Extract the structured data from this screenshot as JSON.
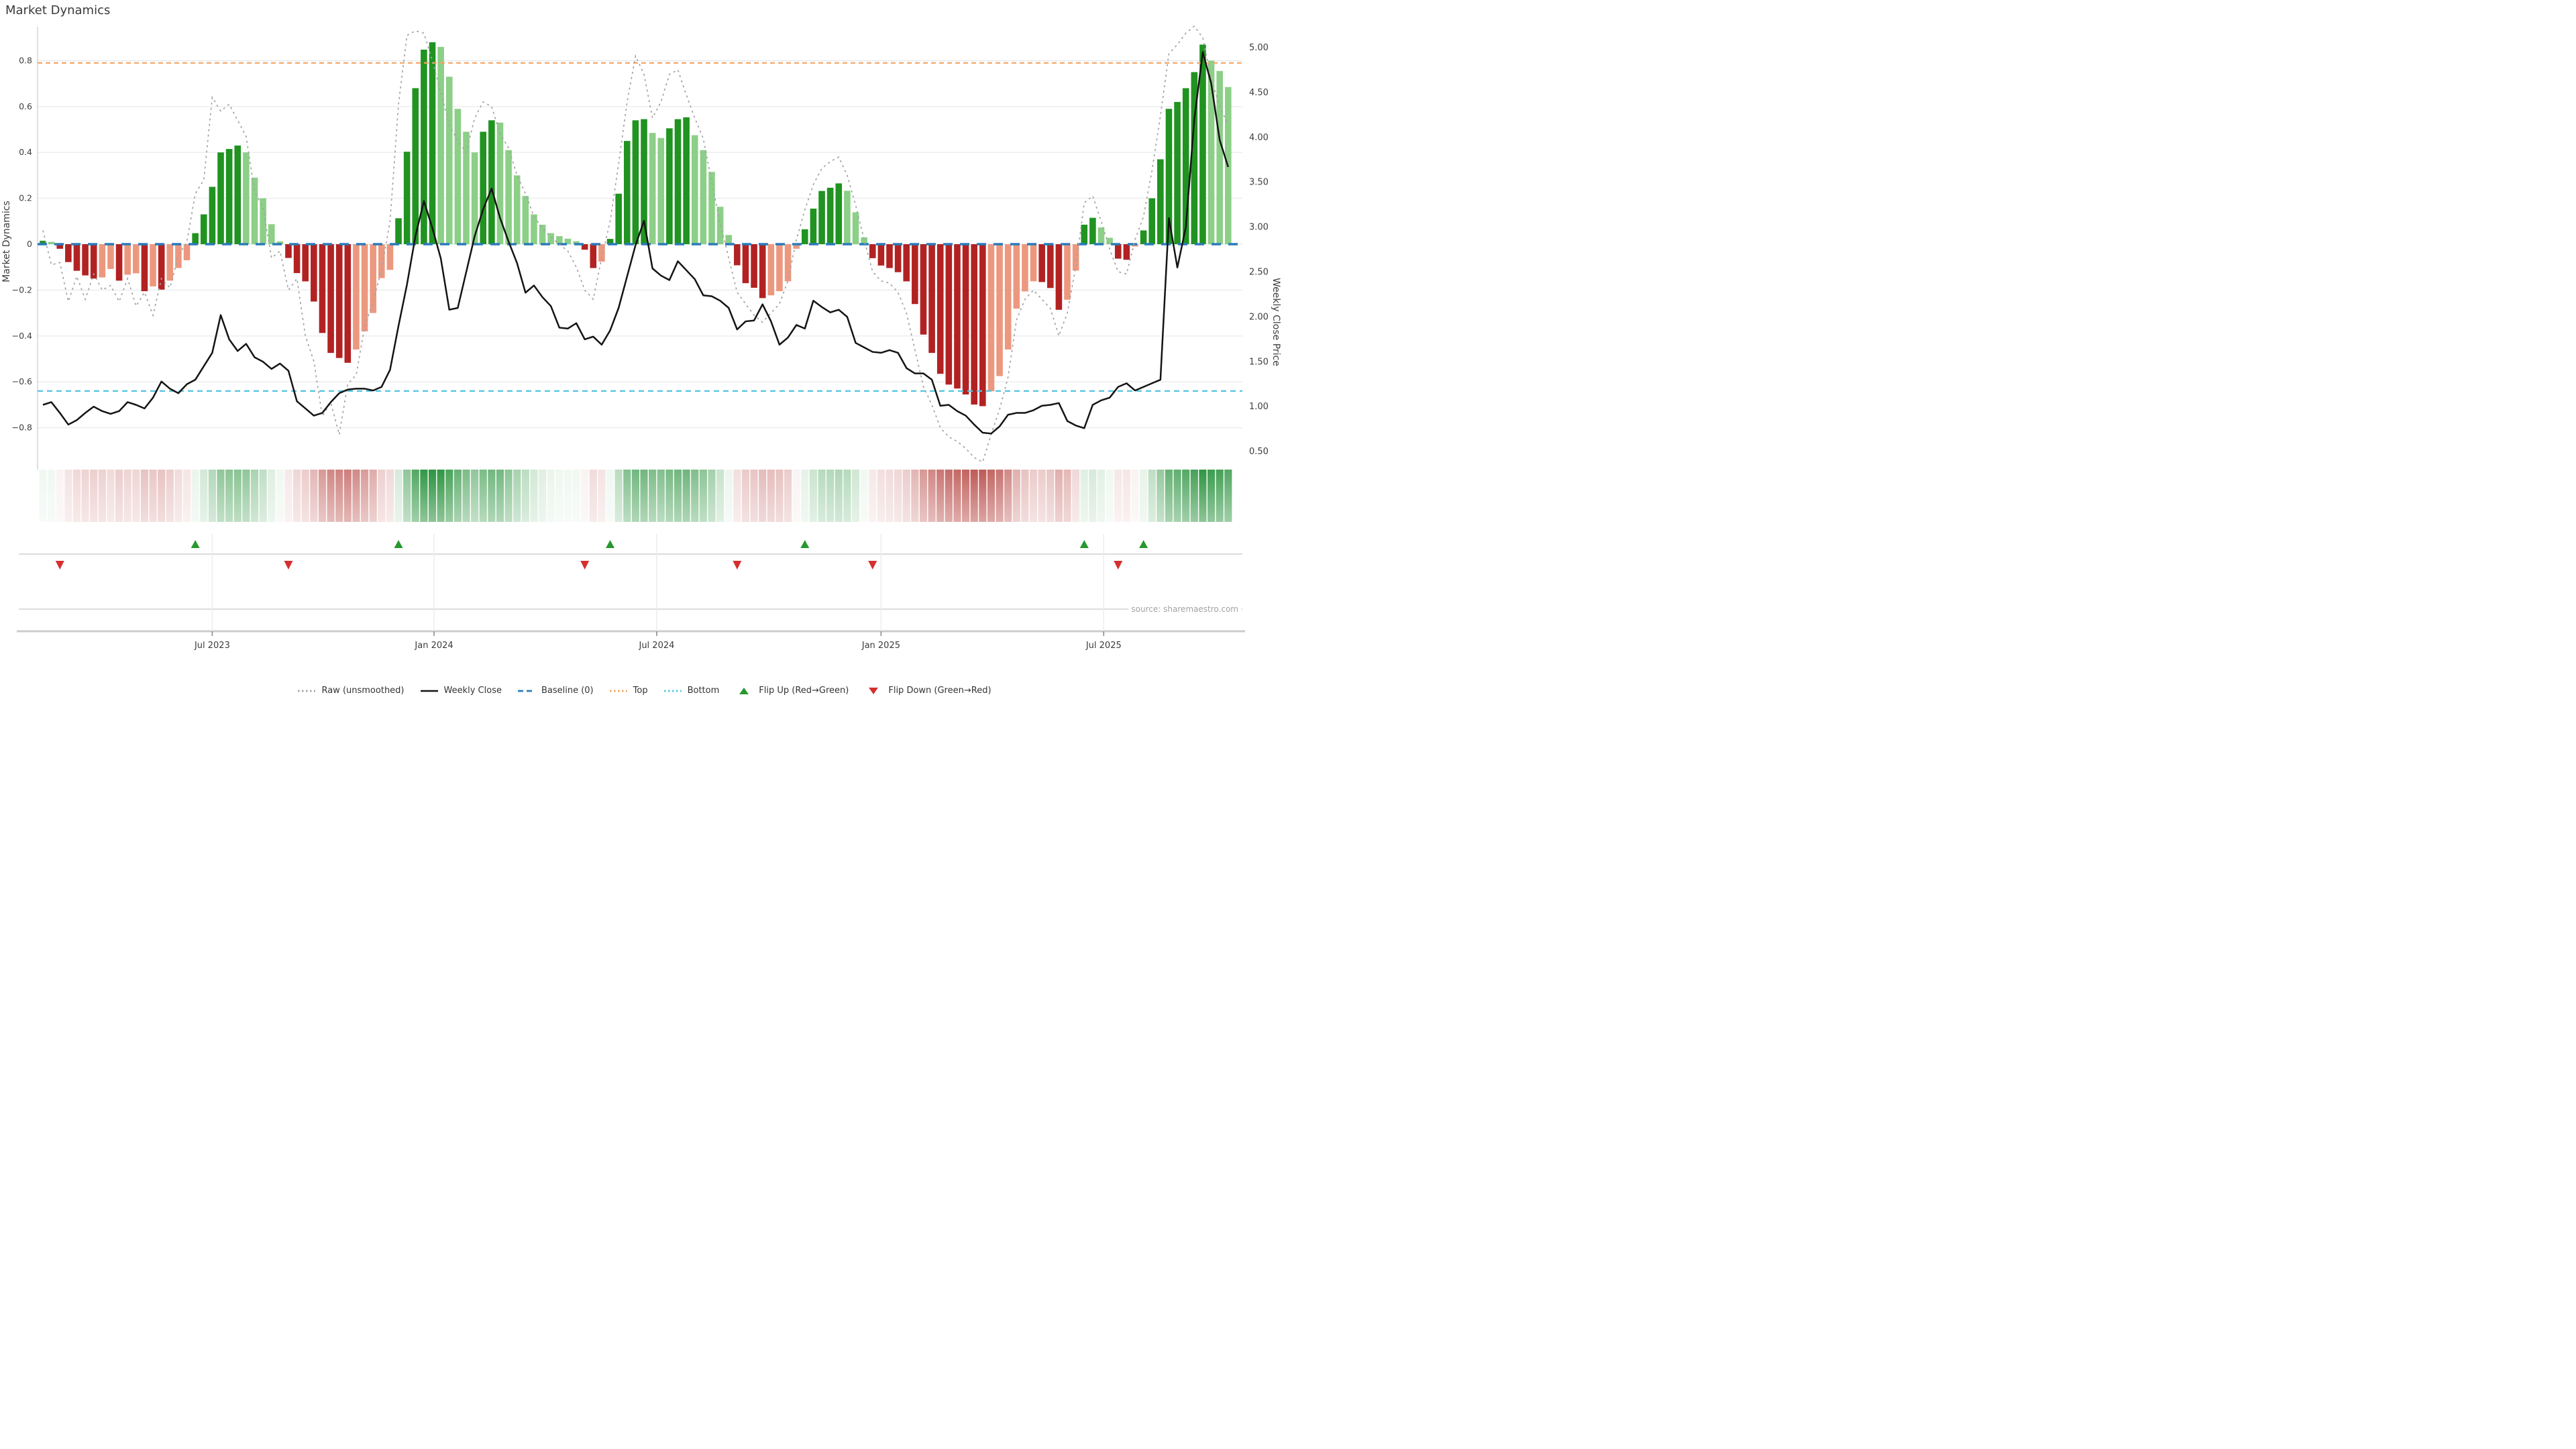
{
  "title": "Market Dynamics",
  "source": "source: sharemaestro.com",
  "axes": {
    "left_label": "Market Dynamics",
    "right_label": "Weekly Close Price",
    "left_tick_labels": [
      "0.8",
      "0.6",
      "0.4",
      "0.2",
      "0",
      "−0.2",
      "−0.4",
      "−0.6",
      "−0.8"
    ],
    "left_tick_values": [
      0.8,
      0.6,
      0.4,
      0.2,
      0,
      -0.2,
      -0.4,
      -0.6,
      -0.8
    ],
    "right_tick_labels": [
      "5.00",
      "4.50",
      "4.00",
      "3.50",
      "3.00",
      "2.50",
      "2.00",
      "1.50",
      "1.00",
      "0.50"
    ],
    "right_tick_values": [
      5.0,
      4.5,
      4.0,
      3.5,
      3.0,
      2.5,
      2.0,
      1.5,
      1.0,
      0.5
    ],
    "x_tick_labels": [
      "Jul 2023",
      "Jan 2024",
      "Jul 2024",
      "Jan 2025",
      "Jul 2025"
    ],
    "x_tick_bar_index": [
      20,
      46.2,
      72.5,
      99,
      125.3
    ]
  },
  "chart_data": {
    "type": "bar",
    "note": "Weekly oscillator bars (left axis) with weekly close price line (right axis); shade D=dark (strengthening), L=light (fading); indices 0-based",
    "baseline": 0,
    "top_threshold": 0.79,
    "bottom_threshold": -0.64,
    "market_dynamics": [
      0.015,
      0.01,
      -0.02,
      -0.078,
      -0.116,
      -0.136,
      -0.15,
      -0.145,
      -0.108,
      -0.159,
      -0.133,
      -0.127,
      -0.205,
      -0.184,
      -0.198,
      -0.159,
      -0.104,
      -0.07,
      0.048,
      0.13,
      0.25,
      0.4,
      0.415,
      0.43,
      0.4,
      0.29,
      0.2,
      0.087,
      0.012,
      -0.06,
      -0.126,
      -0.162,
      -0.25,
      -0.387,
      -0.474,
      -0.496,
      -0.517,
      -0.459,
      -0.38,
      -0.3,
      -0.148,
      -0.112,
      0.113,
      0.403,
      0.68,
      0.848,
      0.88,
      0.86,
      0.73,
      0.59,
      0.49,
      0.4,
      0.49,
      0.54,
      0.53,
      0.41,
      0.3,
      0.21,
      0.13,
      0.085,
      0.048,
      0.035,
      0.024,
      0.013,
      -0.024,
      -0.104,
      -0.076,
      0.023,
      0.22,
      0.45,
      0.54,
      0.545,
      0.485,
      0.463,
      0.505,
      0.545,
      0.553,
      0.475,
      0.41,
      0.315,
      0.163,
      0.04,
      -0.092,
      -0.17,
      -0.19,
      -0.235,
      -0.223,
      -0.205,
      -0.162,
      -0.02,
      0.065,
      0.155,
      0.232,
      0.246,
      0.265,
      0.233,
      0.139,
      0.03,
      -0.061,
      -0.093,
      -0.104,
      -0.122,
      -0.162,
      -0.261,
      -0.394,
      -0.474,
      -0.565,
      -0.612,
      -0.629,
      -0.655,
      -0.699,
      -0.706,
      -0.641,
      -0.575,
      -0.459,
      -0.281,
      -0.206,
      -0.162,
      -0.165,
      -0.191,
      -0.286,
      -0.242,
      -0.115,
      0.085,
      0.115,
      0.073,
      0.028,
      -0.063,
      -0.068,
      -0.01,
      0.06,
      0.2,
      0.37,
      0.59,
      0.62,
      0.68,
      0.75,
      0.87,
      0.8,
      0.755,
      0.685
    ],
    "shade": [
      "D",
      "L",
      "D",
      "D",
      "D",
      "D",
      "D",
      "L",
      "L",
      "D",
      "L",
      "L",
      "D",
      "L",
      "D",
      "L",
      "L",
      "L",
      "D",
      "D",
      "D",
      "D",
      "D",
      "D",
      "L",
      "L",
      "L",
      "L",
      "L",
      "D",
      "D",
      "D",
      "D",
      "D",
      "D",
      "D",
      "D",
      "L",
      "L",
      "L",
      "L",
      "L",
      "D",
      "D",
      "D",
      "D",
      "D",
      "L",
      "L",
      "L",
      "L",
      "L",
      "D",
      "D",
      "L",
      "L",
      "L",
      "L",
      "L",
      "L",
      "L",
      "L",
      "L",
      "L",
      "D",
      "D",
      "L",
      "D",
      "D",
      "D",
      "D",
      "D",
      "L",
      "L",
      "D",
      "D",
      "D",
      "L",
      "L",
      "L",
      "L",
      "L",
      "D",
      "D",
      "D",
      "D",
      "L",
      "L",
      "L",
      "L",
      "D",
      "D",
      "D",
      "D",
      "D",
      "L",
      "L",
      "L",
      "D",
      "D",
      "D",
      "D",
      "D",
      "D",
      "D",
      "D",
      "D",
      "D",
      "D",
      "D",
      "D",
      "D",
      "L",
      "L",
      "L",
      "L",
      "L",
      "L",
      "D",
      "D",
      "D",
      "L",
      "L",
      "D",
      "D",
      "L",
      "L",
      "D",
      "D",
      "L",
      "D",
      "D",
      "D",
      "D",
      "D",
      "D",
      "D",
      "D",
      "L",
      "L",
      "L"
    ],
    "raw_unsmoothed": [
      0.06,
      -0.09,
      -0.08,
      -0.25,
      -0.14,
      -0.24,
      -0.13,
      -0.2,
      -0.18,
      -0.25,
      -0.15,
      -0.27,
      -0.21,
      -0.31,
      -0.15,
      -0.19,
      -0.05,
      0.01,
      0.22,
      0.28,
      0.64,
      0.58,
      0.61,
      0.54,
      0.47,
      0.23,
      0.16,
      -0.06,
      -0.03,
      -0.2,
      -0.15,
      -0.4,
      -0.51,
      -0.75,
      -0.69,
      -0.83,
      -0.61,
      -0.57,
      -0.36,
      -0.25,
      -0.11,
      0.1,
      0.61,
      0.91,
      0.93,
      0.92,
      0.8,
      0.66,
      0.52,
      0.45,
      0.4,
      0.55,
      0.62,
      0.6,
      0.48,
      0.42,
      0.3,
      0.22,
      0.12,
      0.07,
      0.03,
      0.0,
      -0.03,
      -0.1,
      -0.2,
      -0.24,
      -0.06,
      0.1,
      0.35,
      0.62,
      0.82,
      0.74,
      0.55,
      0.62,
      0.74,
      0.76,
      0.65,
      0.55,
      0.46,
      0.27,
      0.09,
      -0.06,
      -0.21,
      -0.26,
      -0.31,
      -0.34,
      -0.3,
      -0.26,
      -0.16,
      0.02,
      0.15,
      0.26,
      0.33,
      0.36,
      0.38,
      0.3,
      0.17,
      0.02,
      -0.12,
      -0.16,
      -0.17,
      -0.21,
      -0.3,
      -0.46,
      -0.62,
      -0.7,
      -0.8,
      -0.84,
      -0.86,
      -0.89,
      -0.93,
      -0.95,
      -0.83,
      -0.72,
      -0.58,
      -0.33,
      -0.24,
      -0.2,
      -0.24,
      -0.28,
      -0.4,
      -0.3,
      -0.1,
      0.18,
      0.21,
      0.1,
      -0.02,
      -0.12,
      -0.13,
      0.02,
      0.12,
      0.32,
      0.56,
      0.83,
      0.87,
      0.92,
      0.95,
      0.9,
      0.72,
      0.6,
      0.52
    ],
    "weekly_close": [
      1.02,
      1.05,
      0.93,
      0.8,
      0.85,
      0.93,
      1.0,
      0.95,
      0.92,
      0.95,
      1.05,
      1.02,
      0.98,
      1.1,
      1.28,
      1.2,
      1.15,
      1.25,
      1.3,
      1.45,
      1.6,
      2.02,
      1.75,
      1.62,
      1.7,
      1.55,
      1.5,
      1.42,
      1.48,
      1.4,
      1.06,
      0.98,
      0.9,
      0.93,
      1.05,
      1.15,
      1.19,
      1.2,
      1.2,
      1.18,
      1.22,
      1.41,
      1.9,
      2.36,
      2.9,
      3.29,
      2.99,
      2.65,
      2.08,
      2.1,
      2.5,
      2.9,
      3.2,
      3.43,
      3.1,
      2.84,
      2.6,
      2.27,
      2.35,
      2.22,
      2.12,
      1.88,
      1.87,
      1.93,
      1.75,
      1.78,
      1.69,
      1.85,
      2.1,
      2.45,
      2.8,
      3.07,
      2.54,
      2.46,
      2.41,
      2.62,
      2.52,
      2.42,
      2.24,
      2.23,
      2.18,
      2.1,
      1.86,
      1.95,
      1.96,
      2.14,
      1.95,
      1.69,
      1.77,
      1.91,
      1.87,
      2.18,
      2.11,
      2.05,
      2.08,
      2.0,
      1.71,
      1.66,
      1.61,
      1.6,
      1.63,
      1.6,
      1.43,
      1.37,
      1.37,
      1.3,
      1.01,
      1.02,
      0.95,
      0.9,
      0.8,
      0.71,
      0.7,
      0.78,
      0.91,
      0.93,
      0.93,
      0.96,
      1.01,
      1.02,
      1.04,
      0.84,
      0.79,
      0.76,
      1.02,
      1.07,
      1.1,
      1.22,
      1.26,
      1.18,
      1.22,
      1.26,
      1.3,
      3.1,
      2.55,
      3.0,
      4.2,
      4.95,
      4.6,
      3.97,
      3.67
    ],
    "flip_up_indices": [
      18,
      42,
      67,
      90,
      123,
      130
    ],
    "flip_down_indices": [
      2,
      29,
      64,
      82,
      98,
      127
    ]
  },
  "legend": [
    {
      "label": "Raw (unsmoothed)",
      "marker": "dotted",
      "color": "#a3a3a3"
    },
    {
      "label": "Weekly Close",
      "marker": "solid",
      "color": "#141414"
    },
    {
      "label": "Baseline (0)",
      "marker": "dashed",
      "color": "#2b7bba"
    },
    {
      "label": "Top",
      "marker": "dotted",
      "color": "#f2a563"
    },
    {
      "label": "Bottom",
      "marker": "dotted",
      "color": "#54c5e0"
    },
    {
      "label": "Flip Up (Red→Green)",
      "marker": "triangle-up",
      "color": "#27982f"
    },
    {
      "label": "Flip Down (Green→Red)",
      "marker": "triangle-down",
      "color": "#d62f2f"
    }
  ],
  "colors": {
    "bar_dark_green": "#209320",
    "bar_light_green": "#8ccf87",
    "bar_dark_red": "#b22222",
    "bar_salmon": "#ec987f",
    "raw_line": "#a3a3a3",
    "close_line": "#141414",
    "baseline": "#2b7bba",
    "top_line": "#f2a563",
    "bottom_line": "#54c5e0",
    "grid": "#e9ecef",
    "spine": "#d8d8d8",
    "tick_text": "#3d3d3d",
    "heat_green": "#2d9440",
    "heat_red": "#bc5450"
  }
}
